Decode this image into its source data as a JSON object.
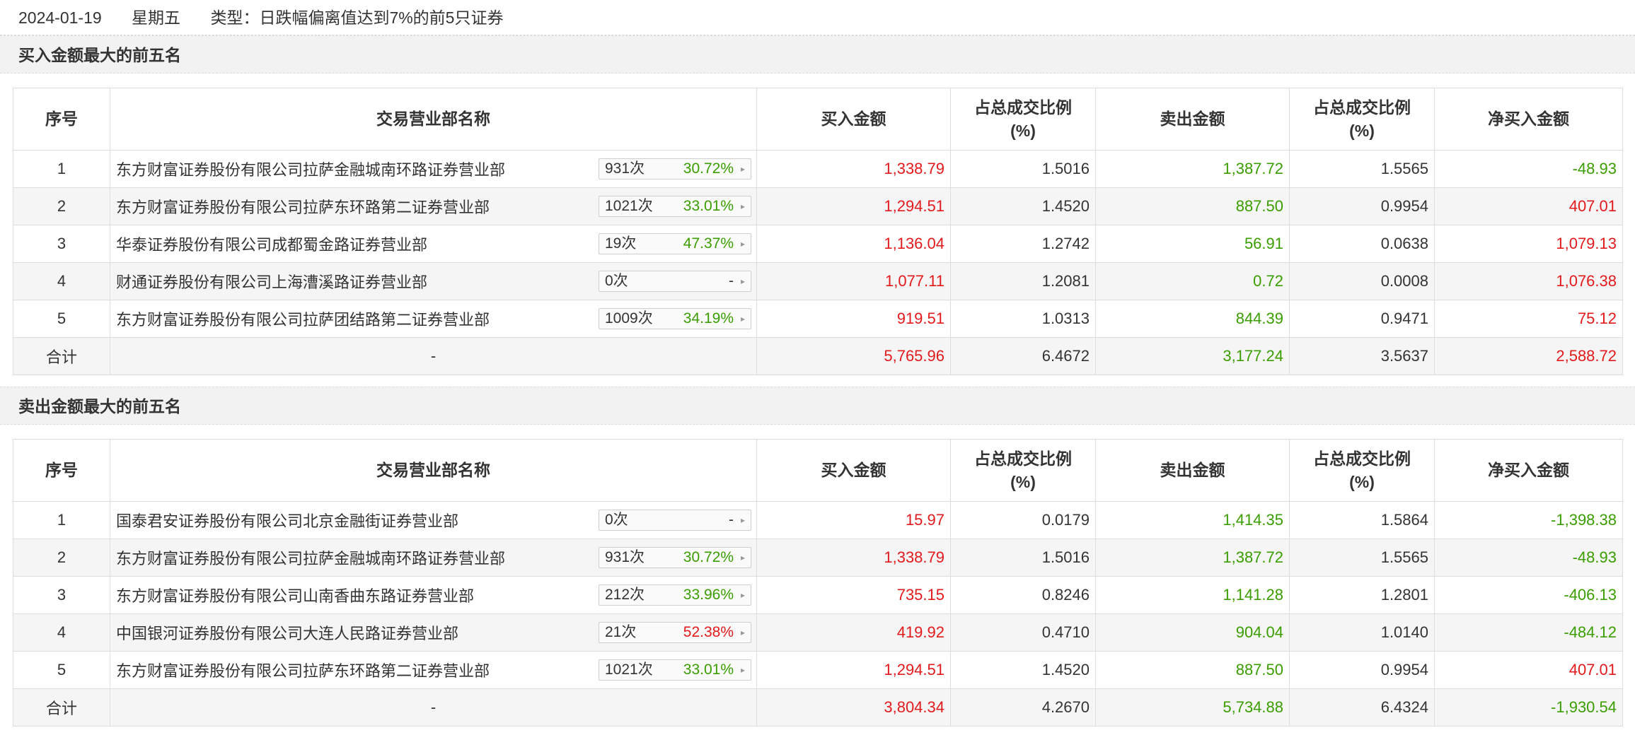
{
  "header": {
    "date": "2024-01-19",
    "weekday": "星期五",
    "type": "类型：日跌幅偏离值达到7%的前5只证券"
  },
  "columns": {
    "seq": "序号",
    "name": "交易营业部名称",
    "buy": "买入金额",
    "buy_ratio_line1": "占总成交比例",
    "buy_ratio_line2": "(%)",
    "sell": "卖出金额",
    "sell_ratio_line1": "占总成交比例",
    "sell_ratio_line2": "(%)",
    "net": "净买入金额"
  },
  "colors": {
    "red": "#e31a1c",
    "green": "#3a9d00"
  },
  "buy_section": {
    "title": "买入金额最大的前五名",
    "rows": [
      {
        "seq": "1",
        "name": "东方财富证券股份有限公司拉萨金融城南环路证券营业部",
        "count": "931次",
        "pct": "30.72%",
        "pct_color": "green",
        "buy": "1,338.79",
        "buy_ratio": "1.5016",
        "sell": "1,387.72",
        "sell_ratio": "1.5565",
        "net": "-48.93",
        "net_color": "green"
      },
      {
        "seq": "2",
        "name": "东方财富证券股份有限公司拉萨东环路第二证券营业部",
        "count": "1021次",
        "pct": "33.01%",
        "pct_color": "green",
        "buy": "1,294.51",
        "buy_ratio": "1.4520",
        "sell": "887.50",
        "sell_ratio": "0.9954",
        "net": "407.01",
        "net_color": "red"
      },
      {
        "seq": "3",
        "name": "华泰证券股份有限公司成都蜀金路证券营业部",
        "count": "19次",
        "pct": "47.37%",
        "pct_color": "green",
        "buy": "1,136.04",
        "buy_ratio": "1.2742",
        "sell": "56.91",
        "sell_ratio": "0.0638",
        "net": "1,079.13",
        "net_color": "red"
      },
      {
        "seq": "4",
        "name": "财通证券股份有限公司上海漕溪路证券营业部",
        "count": "0次",
        "pct": "-",
        "pct_color": "dash",
        "buy": "1,077.11",
        "buy_ratio": "1.2081",
        "sell": "0.72",
        "sell_ratio": "0.0008",
        "net": "1,076.38",
        "net_color": "red"
      },
      {
        "seq": "5",
        "name": "东方财富证券股份有限公司拉萨团结路第二证券营业部",
        "count": "1009次",
        "pct": "34.19%",
        "pct_color": "green",
        "buy": "919.51",
        "buy_ratio": "1.0313",
        "sell": "844.39",
        "sell_ratio": "0.9471",
        "net": "75.12",
        "net_color": "red"
      }
    ],
    "total": {
      "label": "合计",
      "name": "-",
      "buy": "5,765.96",
      "buy_ratio": "6.4672",
      "sell": "3,177.24",
      "sell_ratio": "3.5637",
      "net": "2,588.72",
      "net_color": "red"
    }
  },
  "sell_section": {
    "title": "卖出金额最大的前五名",
    "rows": [
      {
        "seq": "1",
        "name": "国泰君安证券股份有限公司北京金融街证券营业部",
        "count": "0次",
        "pct": "-",
        "pct_color": "dash",
        "buy": "15.97",
        "buy_ratio": "0.0179",
        "sell": "1,414.35",
        "sell_ratio": "1.5864",
        "net": "-1,398.38",
        "net_color": "green"
      },
      {
        "seq": "2",
        "name": "东方财富证券股份有限公司拉萨金融城南环路证券营业部",
        "count": "931次",
        "pct": "30.72%",
        "pct_color": "green",
        "buy": "1,338.79",
        "buy_ratio": "1.5016",
        "sell": "1,387.72",
        "sell_ratio": "1.5565",
        "net": "-48.93",
        "net_color": "green"
      },
      {
        "seq": "3",
        "name": "东方财富证券股份有限公司山南香曲东路证券营业部",
        "count": "212次",
        "pct": "33.96%",
        "pct_color": "green",
        "buy": "735.15",
        "buy_ratio": "0.8246",
        "sell": "1,141.28",
        "sell_ratio": "1.2801",
        "net": "-406.13",
        "net_color": "green"
      },
      {
        "seq": "4",
        "name": "中国银河证券股份有限公司大连人民路证券营业部",
        "count": "21次",
        "pct": "52.38%",
        "pct_color": "red",
        "buy": "419.92",
        "buy_ratio": "0.4710",
        "sell": "904.04",
        "sell_ratio": "1.0140",
        "net": "-484.12",
        "net_color": "green"
      },
      {
        "seq": "5",
        "name": "东方财富证券股份有限公司拉萨东环路第二证券营业部",
        "count": "1021次",
        "pct": "33.01%",
        "pct_color": "green",
        "buy": "1,294.51",
        "buy_ratio": "1.4520",
        "sell": "887.50",
        "sell_ratio": "0.9954",
        "net": "407.01",
        "net_color": "red"
      }
    ],
    "total": {
      "label": "合计",
      "name": "-",
      "buy": "3,804.34",
      "buy_ratio": "4.2670",
      "sell": "5,734.88",
      "sell_ratio": "6.4324",
      "net": "-1,930.54",
      "net_color": "green"
    }
  }
}
